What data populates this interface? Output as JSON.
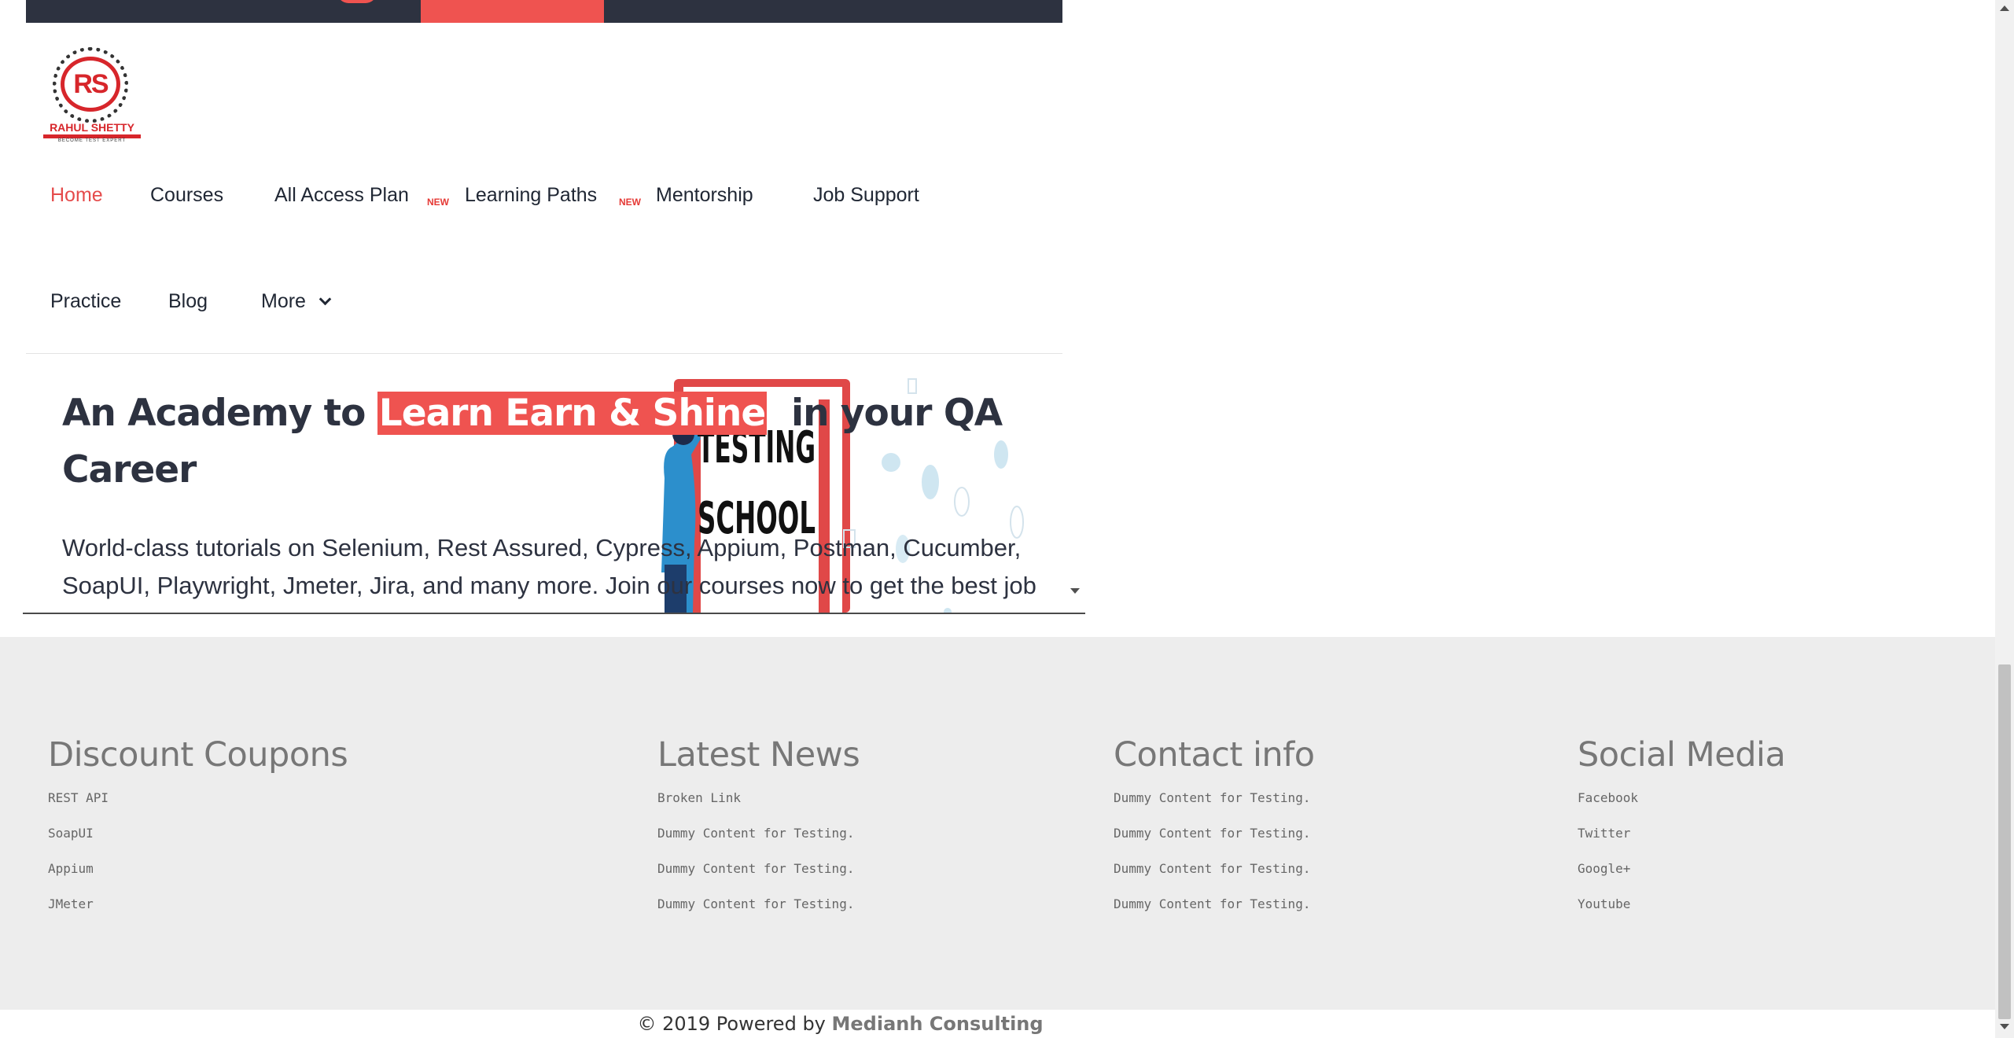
{
  "logo": {
    "mark": "RS",
    "name": "RAHUL SHETTY",
    "tagline": "BECOME TEST EXPERT"
  },
  "nav": {
    "items": [
      {
        "label": "Home",
        "active": true
      },
      {
        "label": "Courses"
      },
      {
        "label": "All Access Plan",
        "badge": "NEW"
      },
      {
        "label": "Learning Paths",
        "badge": "NEW"
      },
      {
        "label": "Mentorship"
      },
      {
        "label": "Job Support"
      },
      {
        "label": "Practice"
      },
      {
        "label": "Blog"
      },
      {
        "label": "More",
        "dropdown": true
      }
    ]
  },
  "hero": {
    "headline_pre": "An Academy to ",
    "headline_highlight": "Learn Earn & Shine",
    "headline_post": "  in your QA Career",
    "description": "World-class tutorials on Selenium, Rest Assured, Cypress, Appium, Postman, Cucumber, SoapUI, Playwright, Jmeter, Jira, and many more. Join our courses now to get the best job",
    "illustration_text": [
      "TESTING",
      "SCHOOL"
    ]
  },
  "footer": {
    "columns": [
      {
        "title": "Discount Coupons",
        "links": [
          "REST API",
          "SoapUI",
          "Appium",
          "JMeter"
        ]
      },
      {
        "title": "Latest News",
        "links": [
          "Broken Link",
          "Dummy Content for Testing.",
          "Dummy Content for Testing.",
          "Dummy Content for Testing."
        ]
      },
      {
        "title": "Contact info",
        "links": [
          "Dummy Content for Testing.",
          "Dummy Content for Testing.",
          "Dummy Content for Testing.",
          "Dummy Content for Testing."
        ]
      },
      {
        "title": "Social Media",
        "links": [
          "Facebook",
          "Twitter",
          "Google+",
          "Youtube"
        ]
      }
    ],
    "copyright_prefix": "© 2019 Powered by ",
    "copyright_link": "Medianh Consulting"
  },
  "colors": {
    "accent": "#ef5350",
    "dark": "#2d3240",
    "footer_bg": "#ededed"
  }
}
